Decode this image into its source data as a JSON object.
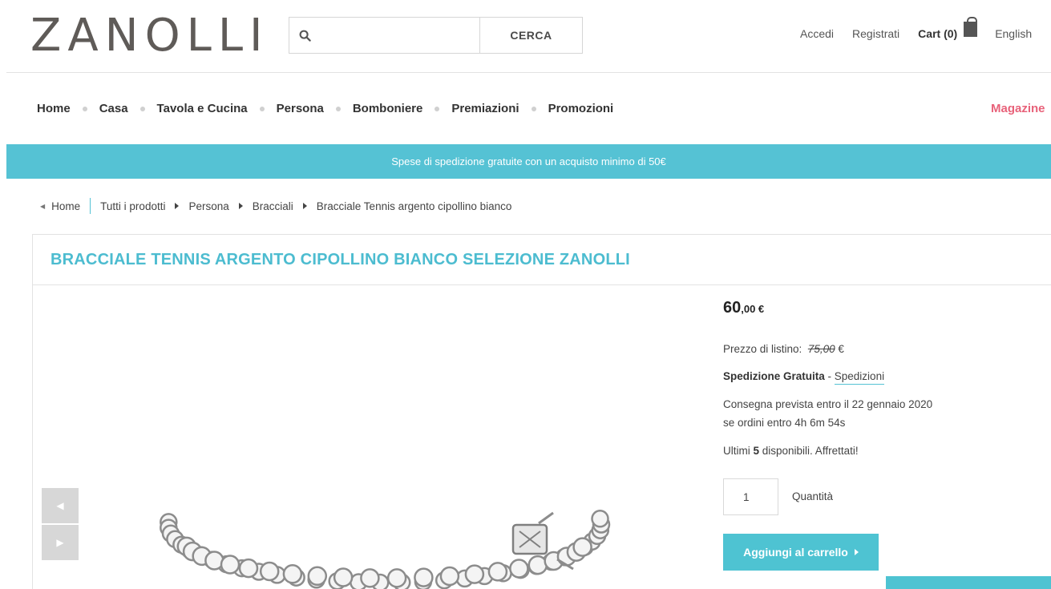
{
  "header": {
    "logo": "ZANOLLI",
    "search_placeholder": "",
    "search_button": "CERCA",
    "links": {
      "login": "Accedi",
      "register": "Registrati",
      "cart": "Cart (0)",
      "language": "English"
    }
  },
  "nav": {
    "items": [
      "Home",
      "Casa",
      "Tavola e Cucina",
      "Persona",
      "Bomboniere",
      "Premiazioni",
      "Promozioni"
    ],
    "magazine": "Magazine"
  },
  "banner": "Spese di spedizione gratuite con un acquisto minimo di 50€",
  "breadcrumb": {
    "items": [
      "Home",
      "Tutti i prodotti",
      "Persona",
      "Bracciali",
      "Bracciale Tennis argento cipollino bianco"
    ]
  },
  "product": {
    "title": "BRACCIALE TENNIS ARGENTO CIPOLLINO BIANCO SELEZIONE ZANOLLI",
    "price_int": "60",
    "price_dec": ",00 €",
    "list_price_label": "Prezzo di listino:",
    "list_price": "75,00",
    "list_price_currency": " €",
    "shipping_bold": "Spedizione Gratuita",
    "shipping_sep": " - ",
    "shipping_link": "Spedizioni",
    "delivery_line1": "Consegna prevista entro il 22 gennaio 2020",
    "delivery_line2": "se ordini entro 4h 6m 54s",
    "stock_prefix": "Ultimi ",
    "stock_count": "5",
    "stock_suffix": " disponibili. Affrettati!",
    "quantity": "1",
    "quantity_label": "Quantità",
    "add_to_cart": "Aggiungi al carrello"
  },
  "colors": {
    "accent": "#55c2d4",
    "magazine": "#e8627a",
    "logo": "#5f5b58"
  },
  "icons": [
    "search-icon",
    "shopping-bag-icon",
    "chevron-left-icon",
    "chevron-right-icon"
  ]
}
